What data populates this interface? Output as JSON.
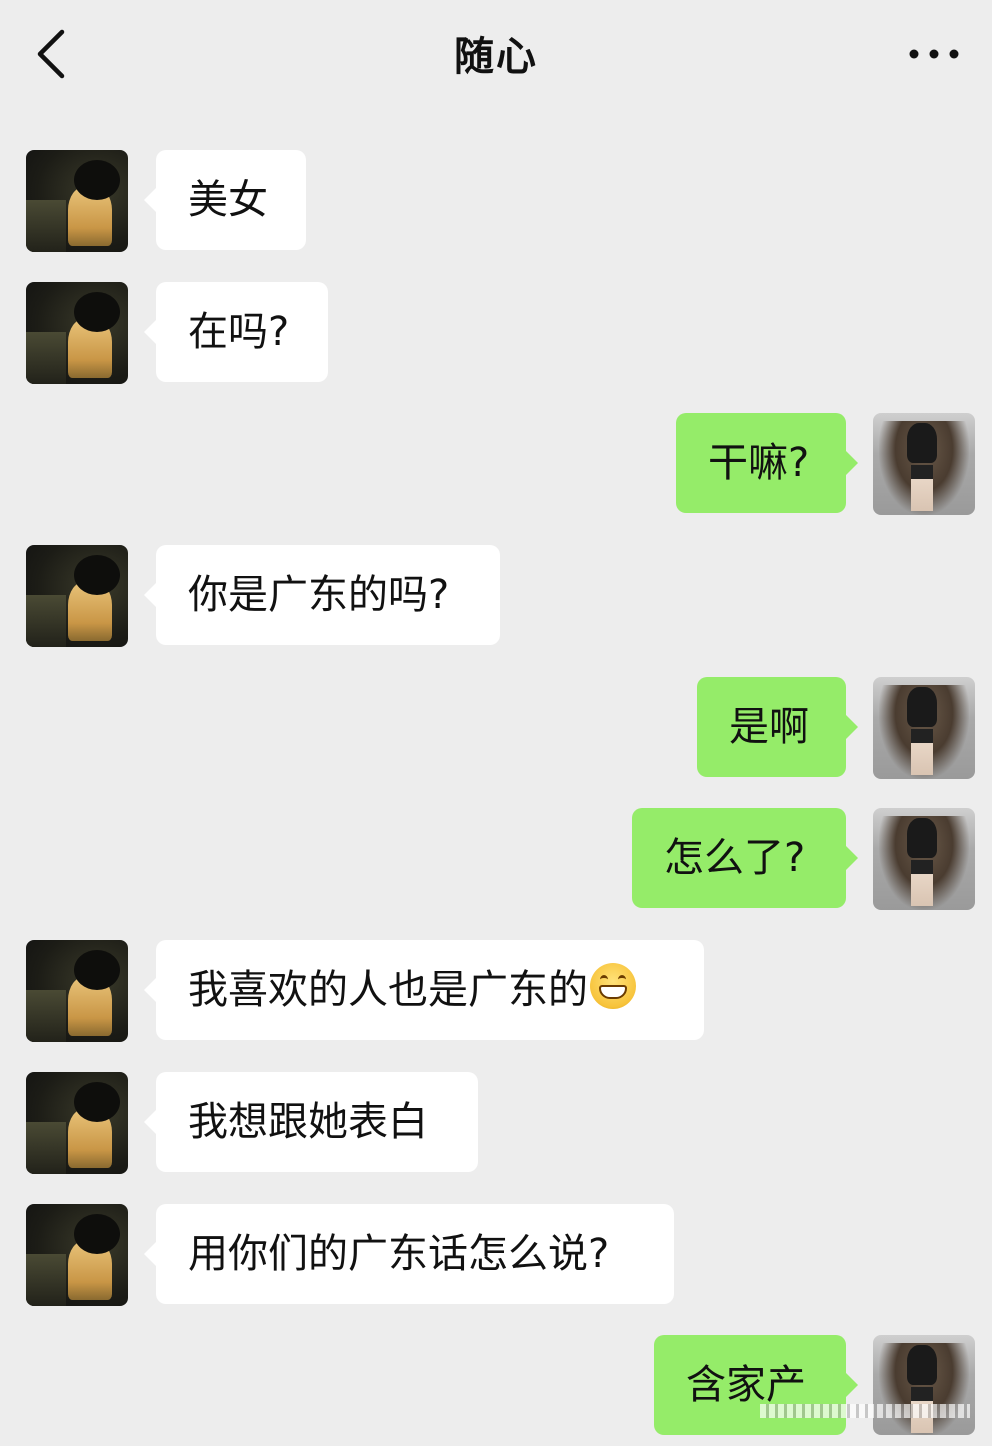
{
  "header": {
    "title": "随心",
    "back_icon": "chevron-left-icon",
    "more_icon": "more-dots-icon"
  },
  "colors": {
    "background": "#ededed",
    "incoming_bubble": "#ffffff",
    "outgoing_bubble": "#95ec69"
  },
  "messages": [
    {
      "side": "left",
      "text": "美女"
    },
    {
      "side": "left",
      "text": "在吗?"
    },
    {
      "side": "right",
      "text": "干嘛?"
    },
    {
      "side": "left",
      "text": "你是广东的吗?"
    },
    {
      "side": "right",
      "text": "是啊"
    },
    {
      "side": "right",
      "text": "怎么了?"
    },
    {
      "side": "left",
      "text": "我喜欢的人也是广东的",
      "emoji": "grinning-face-icon"
    },
    {
      "side": "left",
      "text": "我想跟她表白"
    },
    {
      "side": "left",
      "text": "用你们的广东话怎么说?"
    },
    {
      "side": "right",
      "text": "含家产"
    }
  ]
}
